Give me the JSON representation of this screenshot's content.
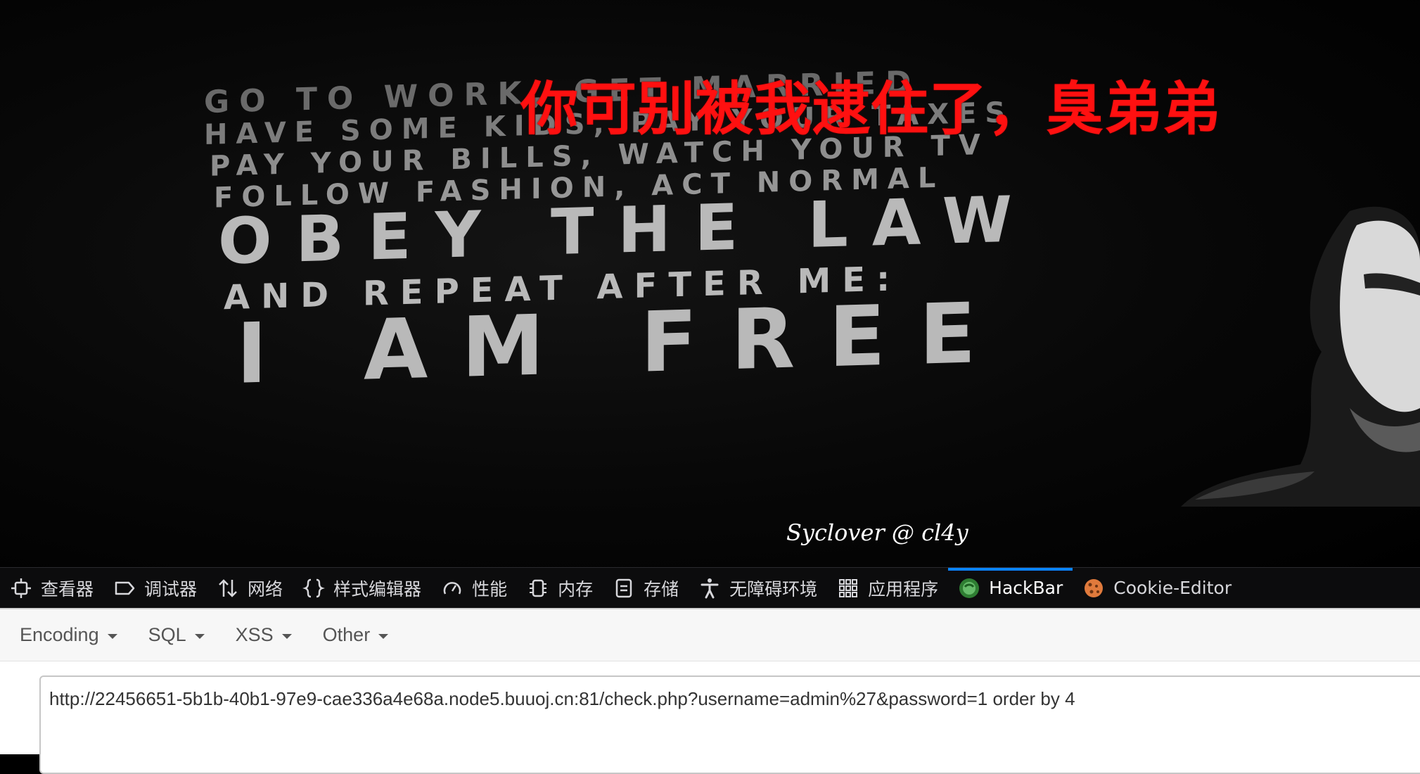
{
  "page": {
    "headline": "你可别被我逮住了，臭弟弟",
    "poster_lines": [
      "GO TO WORK, GET MARRIED",
      "HAVE SOME KIDS, PAY YOUR TAXES",
      "PAY YOUR BILLS, WATCH YOUR TV",
      "FOLLOW FASHION, ACT NORMAL",
      "OBEY THE LAW",
      "AND REPEAT AFTER ME:",
      "I AM FREE"
    ],
    "signature": "Syclover @ cl4y"
  },
  "devtools": {
    "tabs": [
      {
        "label": "查看器",
        "icon": "inspector-icon"
      },
      {
        "label": "调试器",
        "icon": "debugger-icon"
      },
      {
        "label": "网络",
        "icon": "network-icon"
      },
      {
        "label": "样式编辑器",
        "icon": "style-editor-icon"
      },
      {
        "label": "性能",
        "icon": "performance-icon"
      },
      {
        "label": "内存",
        "icon": "memory-icon"
      },
      {
        "label": "存储",
        "icon": "storage-icon"
      },
      {
        "label": "无障碍环境",
        "icon": "accessibility-icon"
      },
      {
        "label": "应用程序",
        "icon": "application-icon"
      },
      {
        "label": "HackBar",
        "icon": "hackbar-icon",
        "active": true
      },
      {
        "label": "Cookie-Editor",
        "icon": "cookie-icon"
      }
    ],
    "active_color": "#0a84ff"
  },
  "hackbar": {
    "menus": [
      "Encoding",
      "SQL",
      "XSS",
      "Other"
    ],
    "url": "http://22456651-5b1b-40b1-97e9-cae336a4e68a.node5.buuoj.cn:81/check.php?username=admin%27&password=1 order by 4"
  },
  "colors": {
    "headline": "#ff1010",
    "devtools_bg": "#0c0c0d"
  }
}
